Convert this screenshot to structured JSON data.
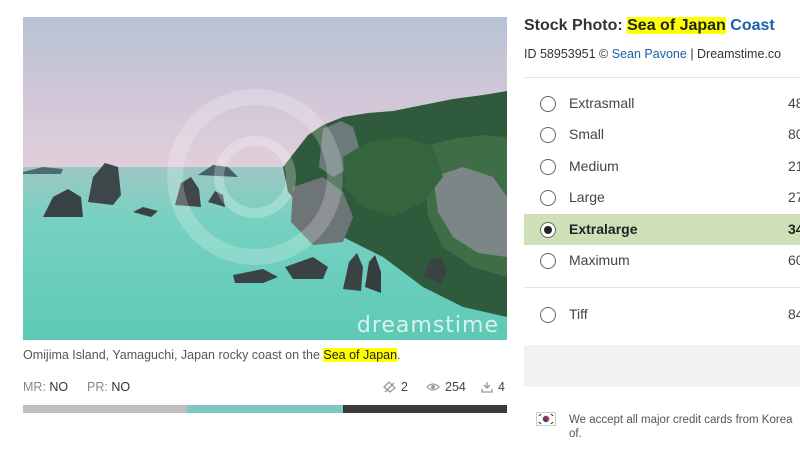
{
  "photo": {
    "alt": "Omijima Island, Yamaguchi, Japan rocky coast",
    "watermark": "dreamstime"
  },
  "caption": {
    "before": "Omijima Island, Yamaguchi, Japan rocky coast on the ",
    "highlight": "Sea of Japan",
    "after": "."
  },
  "releases": {
    "mr_label": "MR:",
    "mr_value": "NO",
    "pr_label": "PR:",
    "pr_value": "NO"
  },
  "stats": {
    "downloads": "2",
    "views": "254",
    "favorites": "4"
  },
  "colors": {
    "highlight": "#ffff00",
    "link": "#1a5fa8",
    "selected_row": "#cfe0b9",
    "palette": [
      "#bfbfbf",
      "#7fc7c1",
      "#3c3c3c"
    ]
  },
  "title": {
    "prefix": "Stock Photo:",
    "highlight": "Sea of Japan",
    "suffix": "Coast"
  },
  "byline": {
    "id_text": "ID 58953951 ©",
    "author": "Sean Pavone",
    "site": "| Dreamstime.co"
  },
  "sizes": [
    {
      "label": "Extrasmall",
      "value": "48",
      "selected": false
    },
    {
      "label": "Small",
      "value": "80",
      "selected": false
    },
    {
      "label": "Medium",
      "value": "21",
      "selected": false
    },
    {
      "label": "Large",
      "value": "27",
      "selected": false
    },
    {
      "label": "Extralarge",
      "value": "34",
      "selected": true
    },
    {
      "label": "Maximum",
      "value": "60",
      "selected": false
    }
  ],
  "tiff": {
    "label": "Tiff",
    "value": "84",
    "selected": false
  },
  "payment": {
    "flag": "south-korea-flag-icon",
    "text_line1": "We accept all major credit cards from Korea",
    "text_line2": "of."
  }
}
